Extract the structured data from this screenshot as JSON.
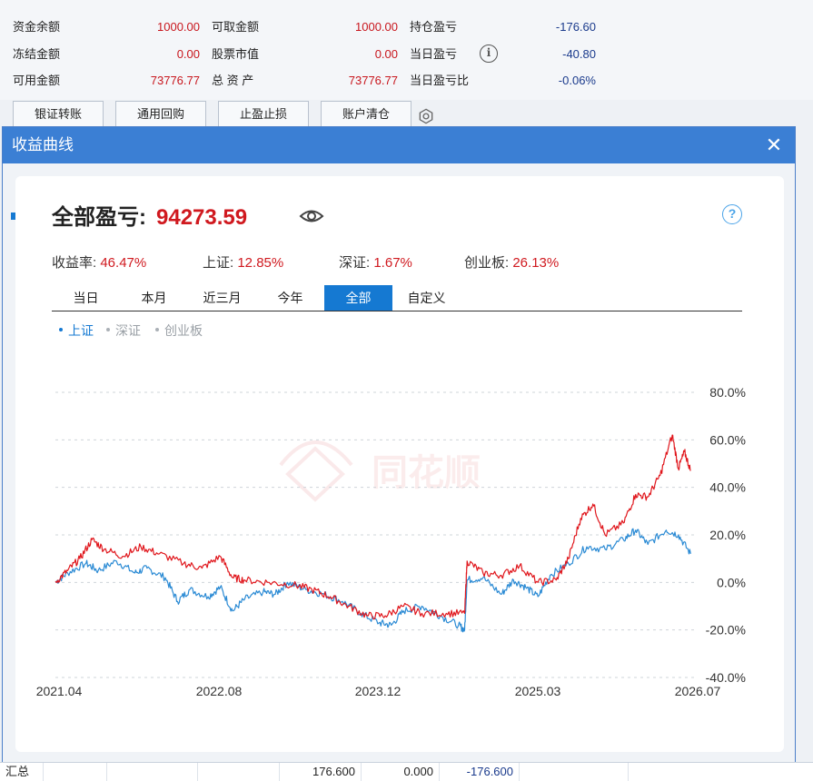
{
  "account": {
    "rows": [
      [
        {
          "label": "资金余额",
          "value": "1000.00"
        },
        {
          "label": "可取金额",
          "value": "1000.00"
        },
        {
          "label": "持仓盈亏",
          "value": "-176.60"
        }
      ],
      [
        {
          "label": "冻结金额",
          "value": "0.00"
        },
        {
          "label": "股票市值",
          "value": "0.00"
        },
        {
          "label": "当日盈亏",
          "value": "-40.80"
        }
      ],
      [
        {
          "label": "可用金额",
          "value": "73776.77"
        },
        {
          "label": "总 资 产",
          "value": "73776.77"
        },
        {
          "label": "当日盈亏比",
          "value": "-0.06%"
        }
      ]
    ],
    "buttons": [
      "银证转账",
      "通用回购",
      "止盈止损",
      "账户清仓"
    ]
  },
  "modal": {
    "title": "收益曲线",
    "close_symbol": "✕",
    "total_label": "全部盈亏:",
    "total_value": "94273.59",
    "stats": [
      {
        "label": "收益率:",
        "value": "46.47%"
      },
      {
        "label": "上证:",
        "value": "12.85%"
      },
      {
        "label": "深证:",
        "value": "1.67%"
      },
      {
        "label": "创业板:",
        "value": "26.13%"
      }
    ],
    "tabs": [
      "当日",
      "本月",
      "近三月",
      "今年",
      "全部",
      "自定义"
    ],
    "active_tab": "全部",
    "legend": [
      {
        "label": "上证",
        "active": true
      },
      {
        "label": "深证",
        "active": false
      },
      {
        "label": "创业板",
        "active": false
      }
    ],
    "watermark": "同花顺"
  },
  "chart_data": {
    "type": "line",
    "x_ticks": [
      "2021.04",
      "2022.08",
      "2023.12",
      "2025.03",
      "2026.07"
    ],
    "y_ticks": [
      "80.0%",
      "60.0%",
      "40.0%",
      "20.0%",
      "0.0%",
      "-20.0%",
      "-40.0%"
    ],
    "ylim": [
      -40,
      80
    ],
    "grid": true,
    "x_domain": [
      2021.25,
      2026.5
    ],
    "series": [
      {
        "color": "#e0161c",
        "points": [
          [
            2021.25,
            0
          ],
          [
            2021.35,
            5
          ],
          [
            2021.45,
            10
          ],
          [
            2021.55,
            18
          ],
          [
            2021.65,
            14
          ],
          [
            2021.8,
            11
          ],
          [
            2021.95,
            15
          ],
          [
            2022.1,
            12
          ],
          [
            2022.3,
            8
          ],
          [
            2022.45,
            6
          ],
          [
            2022.6,
            11
          ],
          [
            2022.7,
            2
          ],
          [
            2022.8,
            1
          ],
          [
            2023.0,
            0
          ],
          [
            2023.2,
            -1
          ],
          [
            2023.35,
            -3
          ],
          [
            2023.5,
            -6
          ],
          [
            2023.65,
            -10
          ],
          [
            2023.8,
            -14
          ],
          [
            2023.95,
            -14
          ],
          [
            2024.1,
            -10
          ],
          [
            2024.25,
            -13
          ],
          [
            2024.45,
            -13
          ],
          [
            2024.6,
            -13
          ],
          [
            2024.62,
            9
          ],
          [
            2024.75,
            4
          ],
          [
            2024.9,
            3
          ],
          [
            2025.05,
            7
          ],
          [
            2025.2,
            0
          ],
          [
            2025.35,
            1
          ],
          [
            2025.45,
            10
          ],
          [
            2025.55,
            27
          ],
          [
            2025.65,
            33
          ],
          [
            2025.75,
            20
          ],
          [
            2025.9,
            25
          ],
          [
            2026.0,
            37
          ],
          [
            2026.1,
            36
          ],
          [
            2026.2,
            45
          ],
          [
            2026.3,
            62
          ],
          [
            2026.35,
            48
          ],
          [
            2026.4,
            55
          ],
          [
            2026.45,
            47
          ]
        ]
      },
      {
        "color": "#2a8ad4",
        "points": [
          [
            2021.25,
            0
          ],
          [
            2021.35,
            4
          ],
          [
            2021.5,
            8
          ],
          [
            2021.6,
            5
          ],
          [
            2021.75,
            9
          ],
          [
            2021.9,
            4
          ],
          [
            2022.0,
            6
          ],
          [
            2022.15,
            2
          ],
          [
            2022.25,
            -8
          ],
          [
            2022.35,
            -3
          ],
          [
            2022.5,
            -6
          ],
          [
            2022.6,
            -2
          ],
          [
            2022.7,
            -12
          ],
          [
            2022.8,
            -7
          ],
          [
            2022.95,
            -4
          ],
          [
            2023.05,
            -5
          ],
          [
            2023.15,
            0
          ],
          [
            2023.3,
            -3
          ],
          [
            2023.45,
            -5
          ],
          [
            2023.6,
            -8
          ],
          [
            2023.75,
            -13
          ],
          [
            2023.9,
            -17
          ],
          [
            2024.0,
            -18
          ],
          [
            2024.1,
            -12
          ],
          [
            2024.25,
            -10
          ],
          [
            2024.4,
            -14
          ],
          [
            2024.55,
            -18
          ],
          [
            2024.6,
            -20
          ],
          [
            2024.62,
            1
          ],
          [
            2024.75,
            2
          ],
          [
            2024.9,
            -5
          ],
          [
            2025.0,
            1
          ],
          [
            2025.1,
            -2
          ],
          [
            2025.2,
            -6
          ],
          [
            2025.3,
            3
          ],
          [
            2025.45,
            8
          ],
          [
            2025.6,
            15
          ],
          [
            2025.75,
            14
          ],
          [
            2025.9,
            18
          ],
          [
            2026.0,
            22
          ],
          [
            2026.1,
            16
          ],
          [
            2026.25,
            22
          ],
          [
            2026.35,
            20
          ],
          [
            2026.45,
            12
          ]
        ]
      }
    ]
  },
  "footer": {
    "label": "汇总",
    "values": [
      "176.600",
      "0.000",
      "-176.600"
    ]
  }
}
